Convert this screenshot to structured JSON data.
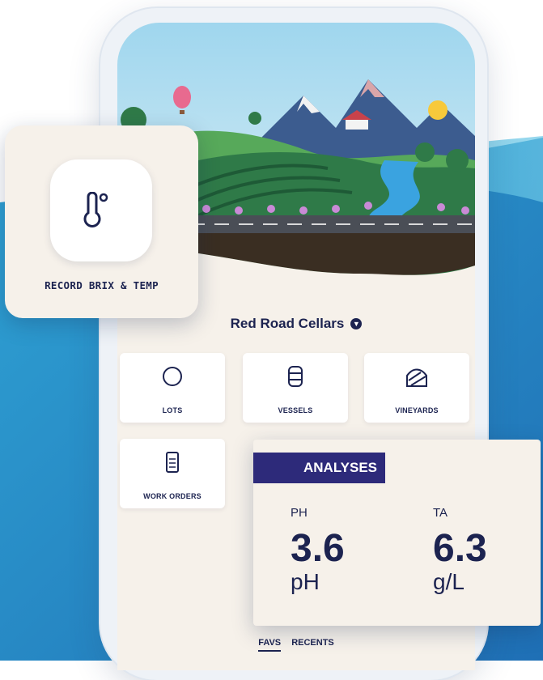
{
  "app": {
    "org_name": "Red Road Cellars",
    "quick_action": {
      "label": "RECORD BRIX & TEMP",
      "icon": "thermometer-icon"
    },
    "tiles": [
      {
        "label": "LOTS",
        "icon": "circle-icon"
      },
      {
        "label": "VESSELS",
        "icon": "barrel-icon"
      },
      {
        "label": "VINEYARDS",
        "icon": "vineyard-icon"
      },
      {
        "label": "WORK ORDERS",
        "icon": "clipboard-icon"
      }
    ],
    "analyses": {
      "title": "ANALYSES",
      "metrics": [
        {
          "label": "PH",
          "value": "3.6",
          "unit": "pH"
        },
        {
          "label": "TA",
          "value": "6.3",
          "unit": "g/L"
        }
      ]
    },
    "tabs": [
      {
        "label": "FAVS",
        "active": true
      },
      {
        "label": "RECENTS",
        "active": false
      }
    ]
  },
  "colors": {
    "navy": "#1c2350",
    "analyses_header": "#2d2a7a",
    "card_bg": "#f6f1ea",
    "accent_blue": "#2a8fc7"
  }
}
